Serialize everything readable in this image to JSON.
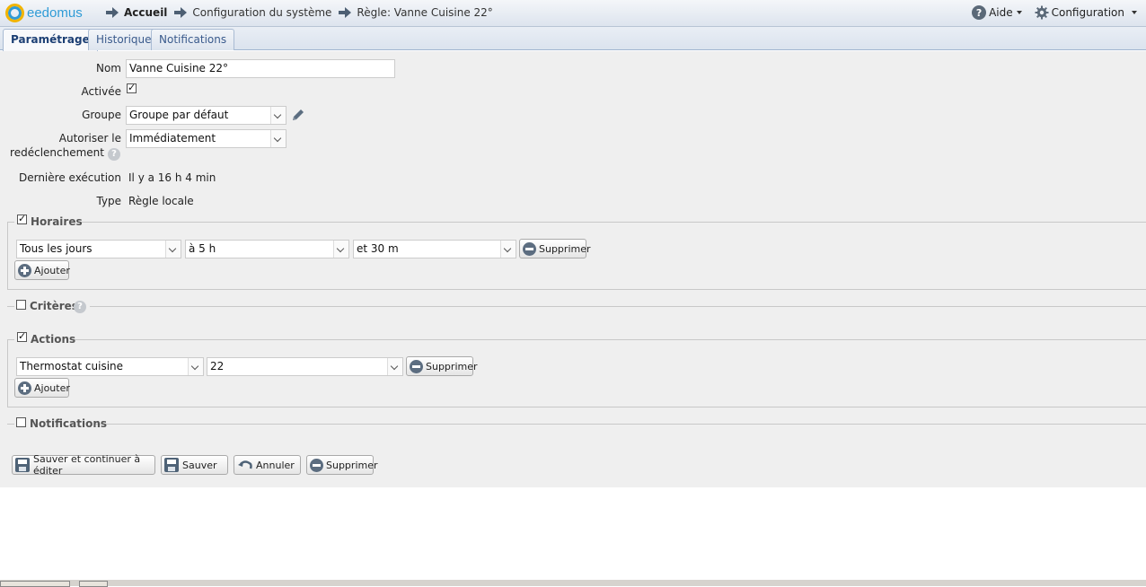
{
  "header": {
    "logo_text": "eedomus",
    "breadcrumbs": [
      "Accueil",
      "Configuration du système",
      "Règle: Vanne Cuisine 22°"
    ],
    "help_label": "Aide",
    "config_label": "Configuration"
  },
  "tabs": [
    "Paramétrage",
    "Historique",
    "Notifications"
  ],
  "form": {
    "name_label": "Nom",
    "name_value": "Vanne Cuisine 22°",
    "active_label": "Activée",
    "active_checked": true,
    "group_label": "Groupe",
    "group_value": "Groupe par défaut",
    "retrigger_label_1": "Autoriser le",
    "retrigger_label_2": "redéclenchement",
    "retrigger_value": "Immédiatement",
    "last_exec_label": "Dernière exécution",
    "last_exec_value": "Il y a 16 h 4 min",
    "type_label": "Type",
    "type_value": "Règle locale"
  },
  "horaires": {
    "title": "Horaires",
    "checked": true,
    "day_value": "Tous les jours",
    "hour_value": "à 5 h",
    "minute_value": "et 30 m",
    "delete_label": "Supprimer",
    "add_label": "Ajouter"
  },
  "criteres": {
    "title": "Critères",
    "checked": false
  },
  "actions": {
    "title": "Actions",
    "checked": true,
    "device_value": "Thermostat cuisine",
    "action_value": "22",
    "delete_label": "Supprimer",
    "add_label": "Ajouter"
  },
  "notifications": {
    "title": "Notifications",
    "checked": false
  },
  "buttons": {
    "save_continue": "Sauver et continuer à éditer",
    "save": "Sauver",
    "cancel": "Annuler",
    "delete": "Supprimer"
  },
  "colors": {
    "accent": "#2f9bd6",
    "logo_ring": "#f1b400",
    "icon_gray": "#5c6d80",
    "tab_text": "#3a5a8c"
  }
}
